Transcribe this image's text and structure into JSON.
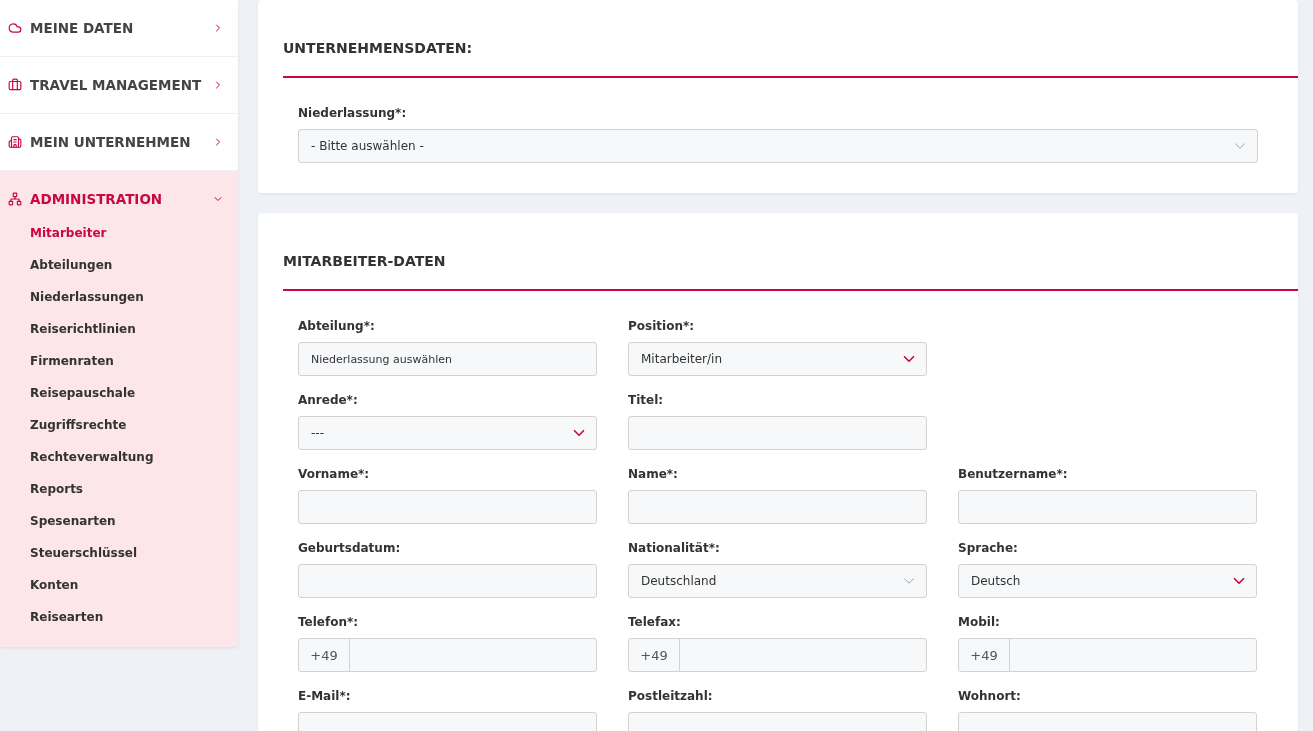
{
  "sidebar": {
    "items": [
      {
        "label": "MEINE DATEN",
        "expanded": false
      },
      {
        "label": "TRAVEL MANAGEMENT",
        "expanded": false
      },
      {
        "label": "MEIN UNTERNEHMEN",
        "expanded": false
      },
      {
        "label": "ADMINISTRATION",
        "expanded": true,
        "children": [
          {
            "label": "Mitarbeiter",
            "selected": true
          },
          {
            "label": "Abteilungen",
            "selected": false
          },
          {
            "label": "Niederlassungen",
            "selected": false
          },
          {
            "label": "Reiserichtlinien",
            "selected": false
          },
          {
            "label": "Firmenraten",
            "selected": false
          },
          {
            "label": "Reisepauschale",
            "selected": false
          },
          {
            "label": "Zugriffsrechte",
            "selected": false
          },
          {
            "label": "Rechteverwaltung",
            "selected": false
          },
          {
            "label": "Reports",
            "selected": false
          },
          {
            "label": "Spesenarten",
            "selected": false
          },
          {
            "label": "Steuerschlüssel",
            "selected": false
          },
          {
            "label": "Konten",
            "selected": false
          },
          {
            "label": "Reisearten",
            "selected": false
          }
        ]
      }
    ]
  },
  "sections": [
    {
      "title": "UNTERNEHMENSDATEN:",
      "fields": [
        {
          "label": "Niederlassung*:",
          "kind": "combo",
          "value": "- Bitte auswählen -"
        }
      ]
    },
    {
      "title": "MITARBEITER-DATEN",
      "fields": [
        {
          "label": "Abteilung*:",
          "kind": "text",
          "value": "Niederlassung auswählen"
        },
        {
          "label": "Position*:",
          "kind": "select",
          "value": "Mitarbeiter/in"
        },
        {
          "kind": "gap"
        },
        {
          "label": "Anrede*:",
          "kind": "select",
          "value": "---"
        },
        {
          "label": "Titel:",
          "kind": "text"
        },
        {
          "kind": "gap"
        },
        {
          "label": "Vorname*:",
          "kind": "text"
        },
        {
          "label": "Name*:",
          "kind": "text"
        },
        {
          "label": "Benutzername*:",
          "kind": "text"
        },
        {
          "label": "Geburtsdatum:",
          "kind": "text"
        },
        {
          "label": "Nationalität*:",
          "kind": "combo",
          "value": "Deutschland"
        },
        {
          "label": "Sprache:",
          "kind": "select",
          "value": "Deutsch"
        },
        {
          "label": "Telefon*:",
          "kind": "phone",
          "prefix": "+49"
        },
        {
          "label": "Telefax:",
          "kind": "phone",
          "prefix": "+49"
        },
        {
          "label": "Mobil:",
          "kind": "phone",
          "prefix": "+49"
        },
        {
          "label": "E-Mail*:",
          "kind": "text"
        },
        {
          "label": "Postleitzahl:",
          "kind": "text"
        },
        {
          "label": "Wohnort:",
          "kind": "text"
        }
      ]
    }
  ]
}
